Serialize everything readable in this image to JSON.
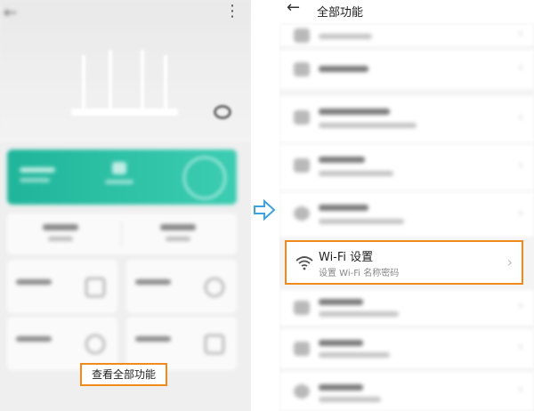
{
  "left_screen": {
    "button_view_all": "查看全部功能"
  },
  "right_screen": {
    "title": "全部功能",
    "wifi_item": {
      "title": "Wi-Fi 设置",
      "subtitle": "设置 Wi-Fi 名称密码"
    }
  },
  "colors": {
    "highlight": "#f08a1b",
    "accent_green": "#2bc0a3",
    "arrow": "#3aa3e3"
  },
  "icons": {
    "back": "back-arrow-icon",
    "more": "more-vertical-icon",
    "wifi": "wifi-icon",
    "chevron": "chevron-right-icon",
    "transition": "arrow-right-icon"
  }
}
